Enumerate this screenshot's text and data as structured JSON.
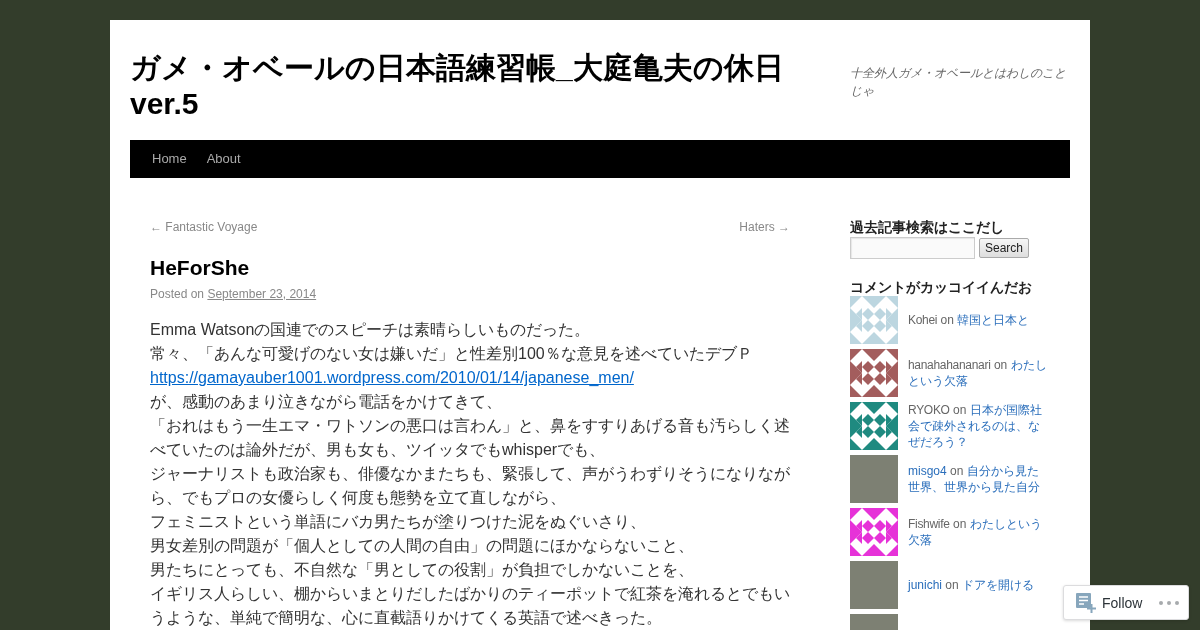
{
  "site": {
    "title": "ガメ・オベールの日本語練習帳_大庭亀夫の休日ver.5",
    "description": "十全外人ガメ・オベールとはわしのことじゃ"
  },
  "menu": [
    {
      "label": "Home"
    },
    {
      "label": "About"
    }
  ],
  "post": {
    "nav_previous": "← Fantastic Voyage",
    "nav_next": "Haters →",
    "title": "HeForShe",
    "meta": {
      "prefix": "Posted on",
      "date": "September 23, 2014"
    },
    "body": [
      {
        "kind": "text",
        "text": "Emma Watsonの国連でのスピーチは素晴らしいものだった。"
      },
      {
        "kind": "text",
        "text": "常々、「あんな可愛げのない女は嫌いだ」と性差別100％な意見を述べていたデブＰ"
      },
      {
        "kind": "link",
        "text": "https://gamayauber1001.wordpress.com/2010/01/14/japanese_men/"
      },
      {
        "kind": "text",
        "text": "が、感動のあまり泣きながら電話をかけてきて、"
      },
      {
        "kind": "text",
        "text": "「おれはもう一生エマ・ワトソンの悪口は言わん」と、鼻をすすりあげる音も汚らしく述べていたのは論外だが、男も女も、ツイッタでもwhisperでも、"
      },
      {
        "kind": "text",
        "text": "ジャーナリストも政治家も、俳優なかまたちも、緊張して、声がうわずりそうになりながら、でもプロの女優らしく何度も態勢を立て直しながら、"
      },
      {
        "kind": "text",
        "text": "フェミニストという単語にバカ男たちが塗りつけた泥をぬぐいさり、"
      },
      {
        "kind": "text",
        "text": "男女差別の問題が「個人としての人間の自由」の問題にほかならないこと、"
      },
      {
        "kind": "text",
        "text": "男たちにとっても、不自然な「男としての役割」が負担でしかないことを、"
      },
      {
        "kind": "text",
        "text": "イギリス人らしい、棚からいまとりだしたばかりのティーポットで紅茶を淹れるとでもいうような、単純で簡明な、心に直截語りかけてくる英語で述べきった。"
      }
    ]
  },
  "sidebar": {
    "search": {
      "title": "過去記事検索はここだし",
      "button": "Search"
    },
    "comments": {
      "title": "コメントがカッコイイんだお",
      "items": [
        {
          "author": "Kohei",
          "author_link": false,
          "on": "on",
          "post": "韓国と日本と",
          "avatar": {
            "kind": "identicon",
            "color": "#bcd6e0"
          }
        },
        {
          "author": "hanahahananari",
          "author_link": false,
          "on": "on",
          "post": "わたしという欠落",
          "avatar": {
            "kind": "identicon",
            "color": "#a35d5d"
          }
        },
        {
          "author": "RYOKO",
          "author_link": false,
          "on": "on",
          "post": "日本が国際社会で疎外されるのは、なぜだろう？",
          "avatar": {
            "kind": "identicon",
            "color": "#1f8a80"
          }
        },
        {
          "author": "misgo4",
          "author_link": true,
          "on": "on",
          "post": "自分から見た世界、世界から見た自分",
          "avatar": {
            "kind": "photo"
          }
        },
        {
          "author": "Fishwife",
          "author_link": false,
          "on": "on",
          "post": "わたしという欠落",
          "avatar": {
            "kind": "identicon",
            "color": "#e632d8"
          }
        },
        {
          "author": "junichi",
          "author_link": true,
          "on": "on",
          "post": "ドアを開ける",
          "avatar": {
            "kind": "photo"
          }
        },
        {
          "avatar": {
            "kind": "photo"
          }
        }
      ]
    }
  },
  "action_bar": {
    "follow": "Follow"
  }
}
